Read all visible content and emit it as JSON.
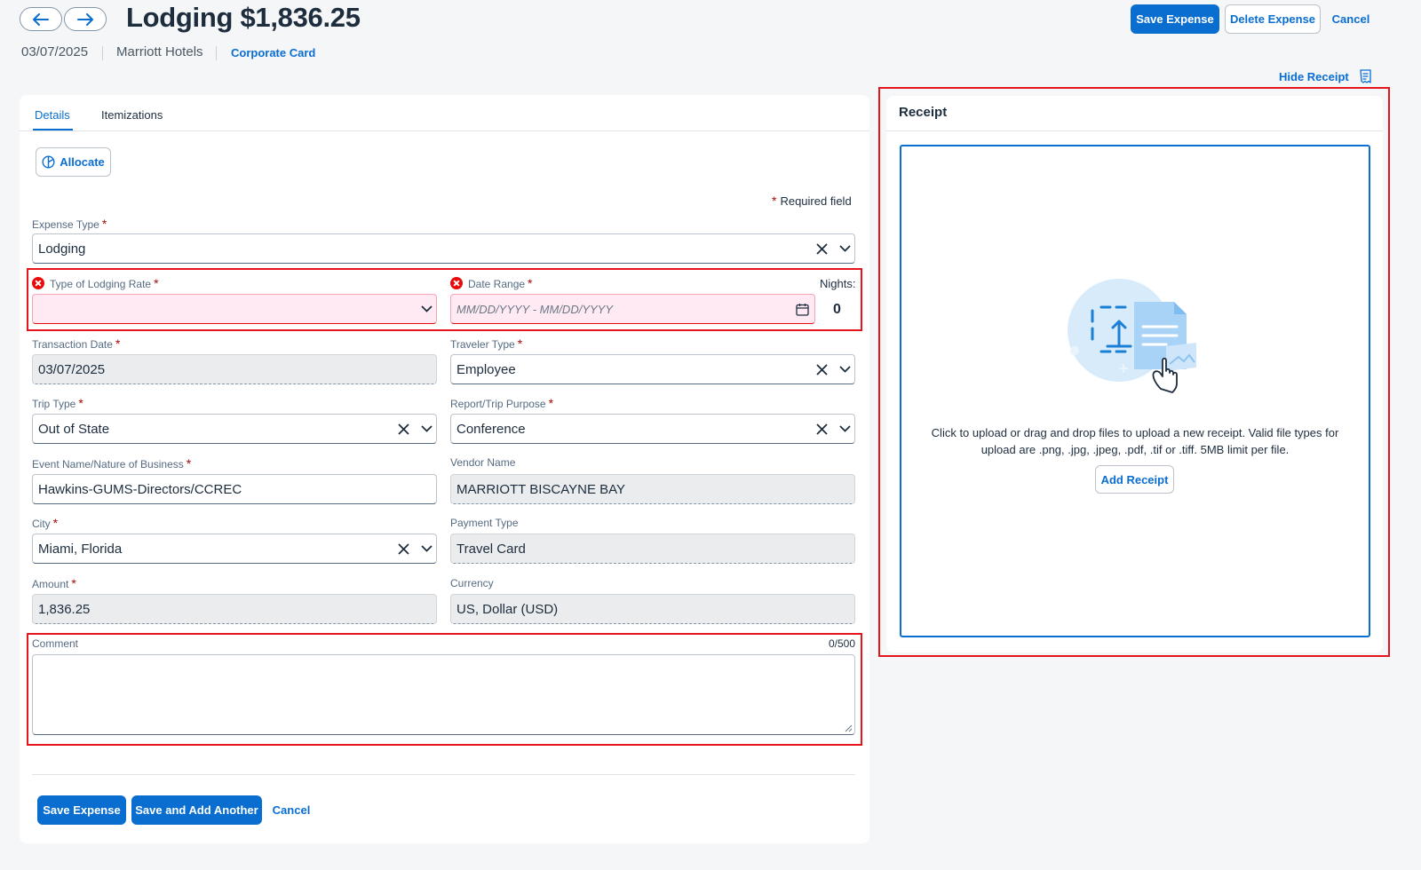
{
  "header": {
    "title": "Lodging $1,836.25",
    "date": "03/07/2025",
    "vendor": "Marriott Hotels",
    "payment_link": "Corporate Card",
    "save_label": "Save Expense",
    "delete_label": "Delete Expense",
    "cancel_label": "Cancel",
    "hide_receipt_label": "Hide Receipt"
  },
  "tabs": [
    {
      "label": "Details",
      "active": true
    },
    {
      "label": "Itemizations",
      "active": false
    }
  ],
  "form": {
    "allocate_label": "Allocate",
    "required_note": "Required field",
    "expense_type": {
      "label": "Expense Type",
      "value": "Lodging"
    },
    "lodging_rate": {
      "label": "Type of Lodging Rate",
      "value": ""
    },
    "date_range": {
      "label": "Date Range",
      "placeholder": "MM/DD/YYYY - MM/DD/YYYY"
    },
    "nights": {
      "label": "Nights:",
      "value": "0"
    },
    "transaction_date": {
      "label": "Transaction Date",
      "value": "03/07/2025"
    },
    "traveler_type": {
      "label": "Traveler Type",
      "value": "Employee"
    },
    "trip_type": {
      "label": "Trip Type",
      "value": "Out of State"
    },
    "trip_purpose": {
      "label": "Report/Trip Purpose",
      "value": "Conference"
    },
    "event_name": {
      "label": "Event Name/Nature of Business",
      "value": "Hawkins-GUMS-Directors/CCREC"
    },
    "vendor_name": {
      "label": "Vendor Name",
      "value": "MARRIOTT BISCAYNE BAY"
    },
    "city": {
      "label": "City",
      "value": "Miami, Florida"
    },
    "payment_type": {
      "label": "Payment Type",
      "value": "Travel Card"
    },
    "amount": {
      "label": "Amount",
      "value": "1,836.25"
    },
    "currency": {
      "label": "Currency",
      "value": "US, Dollar (USD)"
    },
    "comment": {
      "label": "Comment",
      "counter": "0/500",
      "value": ""
    }
  },
  "footer": {
    "save_label": "Save Expense",
    "save_another_label": "Save and Add Another",
    "cancel_label": "Cancel"
  },
  "receipt": {
    "title": "Receipt",
    "instructions": "Click to upload or drag and drop files to upload a new receipt. Valid file types for upload are .png, .jpg, .jpeg, .pdf, .tif or .tiff. 5MB limit per file.",
    "add_label": "Add Receipt"
  },
  "colors": {
    "primary": "#0a6ed1",
    "error": "#e90b0b",
    "highlight_box": "#e5151b"
  }
}
